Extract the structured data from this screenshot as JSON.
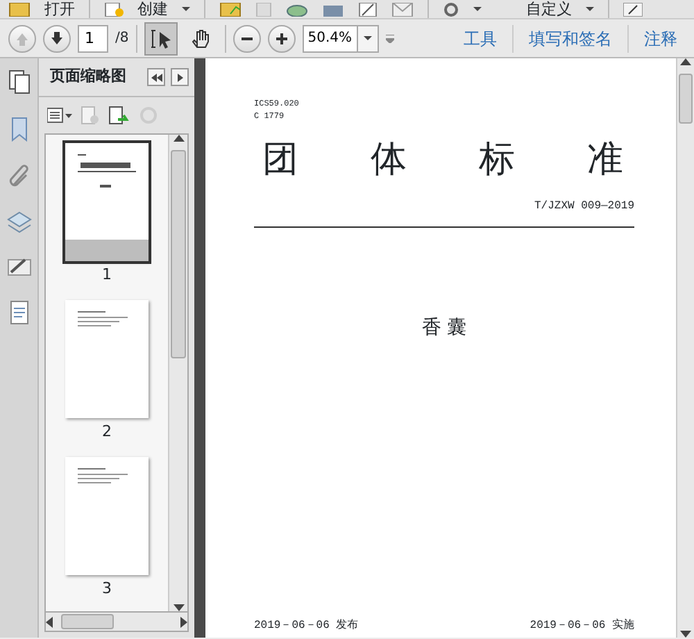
{
  "main_toolbar": {
    "open_label": "打开",
    "create_label": "创建",
    "customize_label": "自定义"
  },
  "nav_toolbar": {
    "page": "1",
    "page_count": "/8",
    "zoom": "50.4%",
    "tools": [
      {
        "kind": "select",
        "selected": true
      },
      {
        "kind": "hand",
        "selected": false
      }
    ],
    "panes": [
      "工具",
      "填写和签名",
      "注释"
    ]
  },
  "sidebar": {
    "title": "页面缩略图",
    "thumbnails": [
      {
        "label": "1",
        "selected": true
      },
      {
        "label": "2",
        "selected": false
      },
      {
        "label": "3",
        "selected": false
      }
    ]
  },
  "document": {
    "ics": "ICS59.020",
    "ccs": "C 1779",
    "title_chars": [
      "团",
      "体",
      "标",
      "准"
    ],
    "number": "T/JZXW 009—2019",
    "name": "香 囊",
    "issued": "2019－06－06 发布",
    "implemented": "2019－06－06 实施"
  }
}
